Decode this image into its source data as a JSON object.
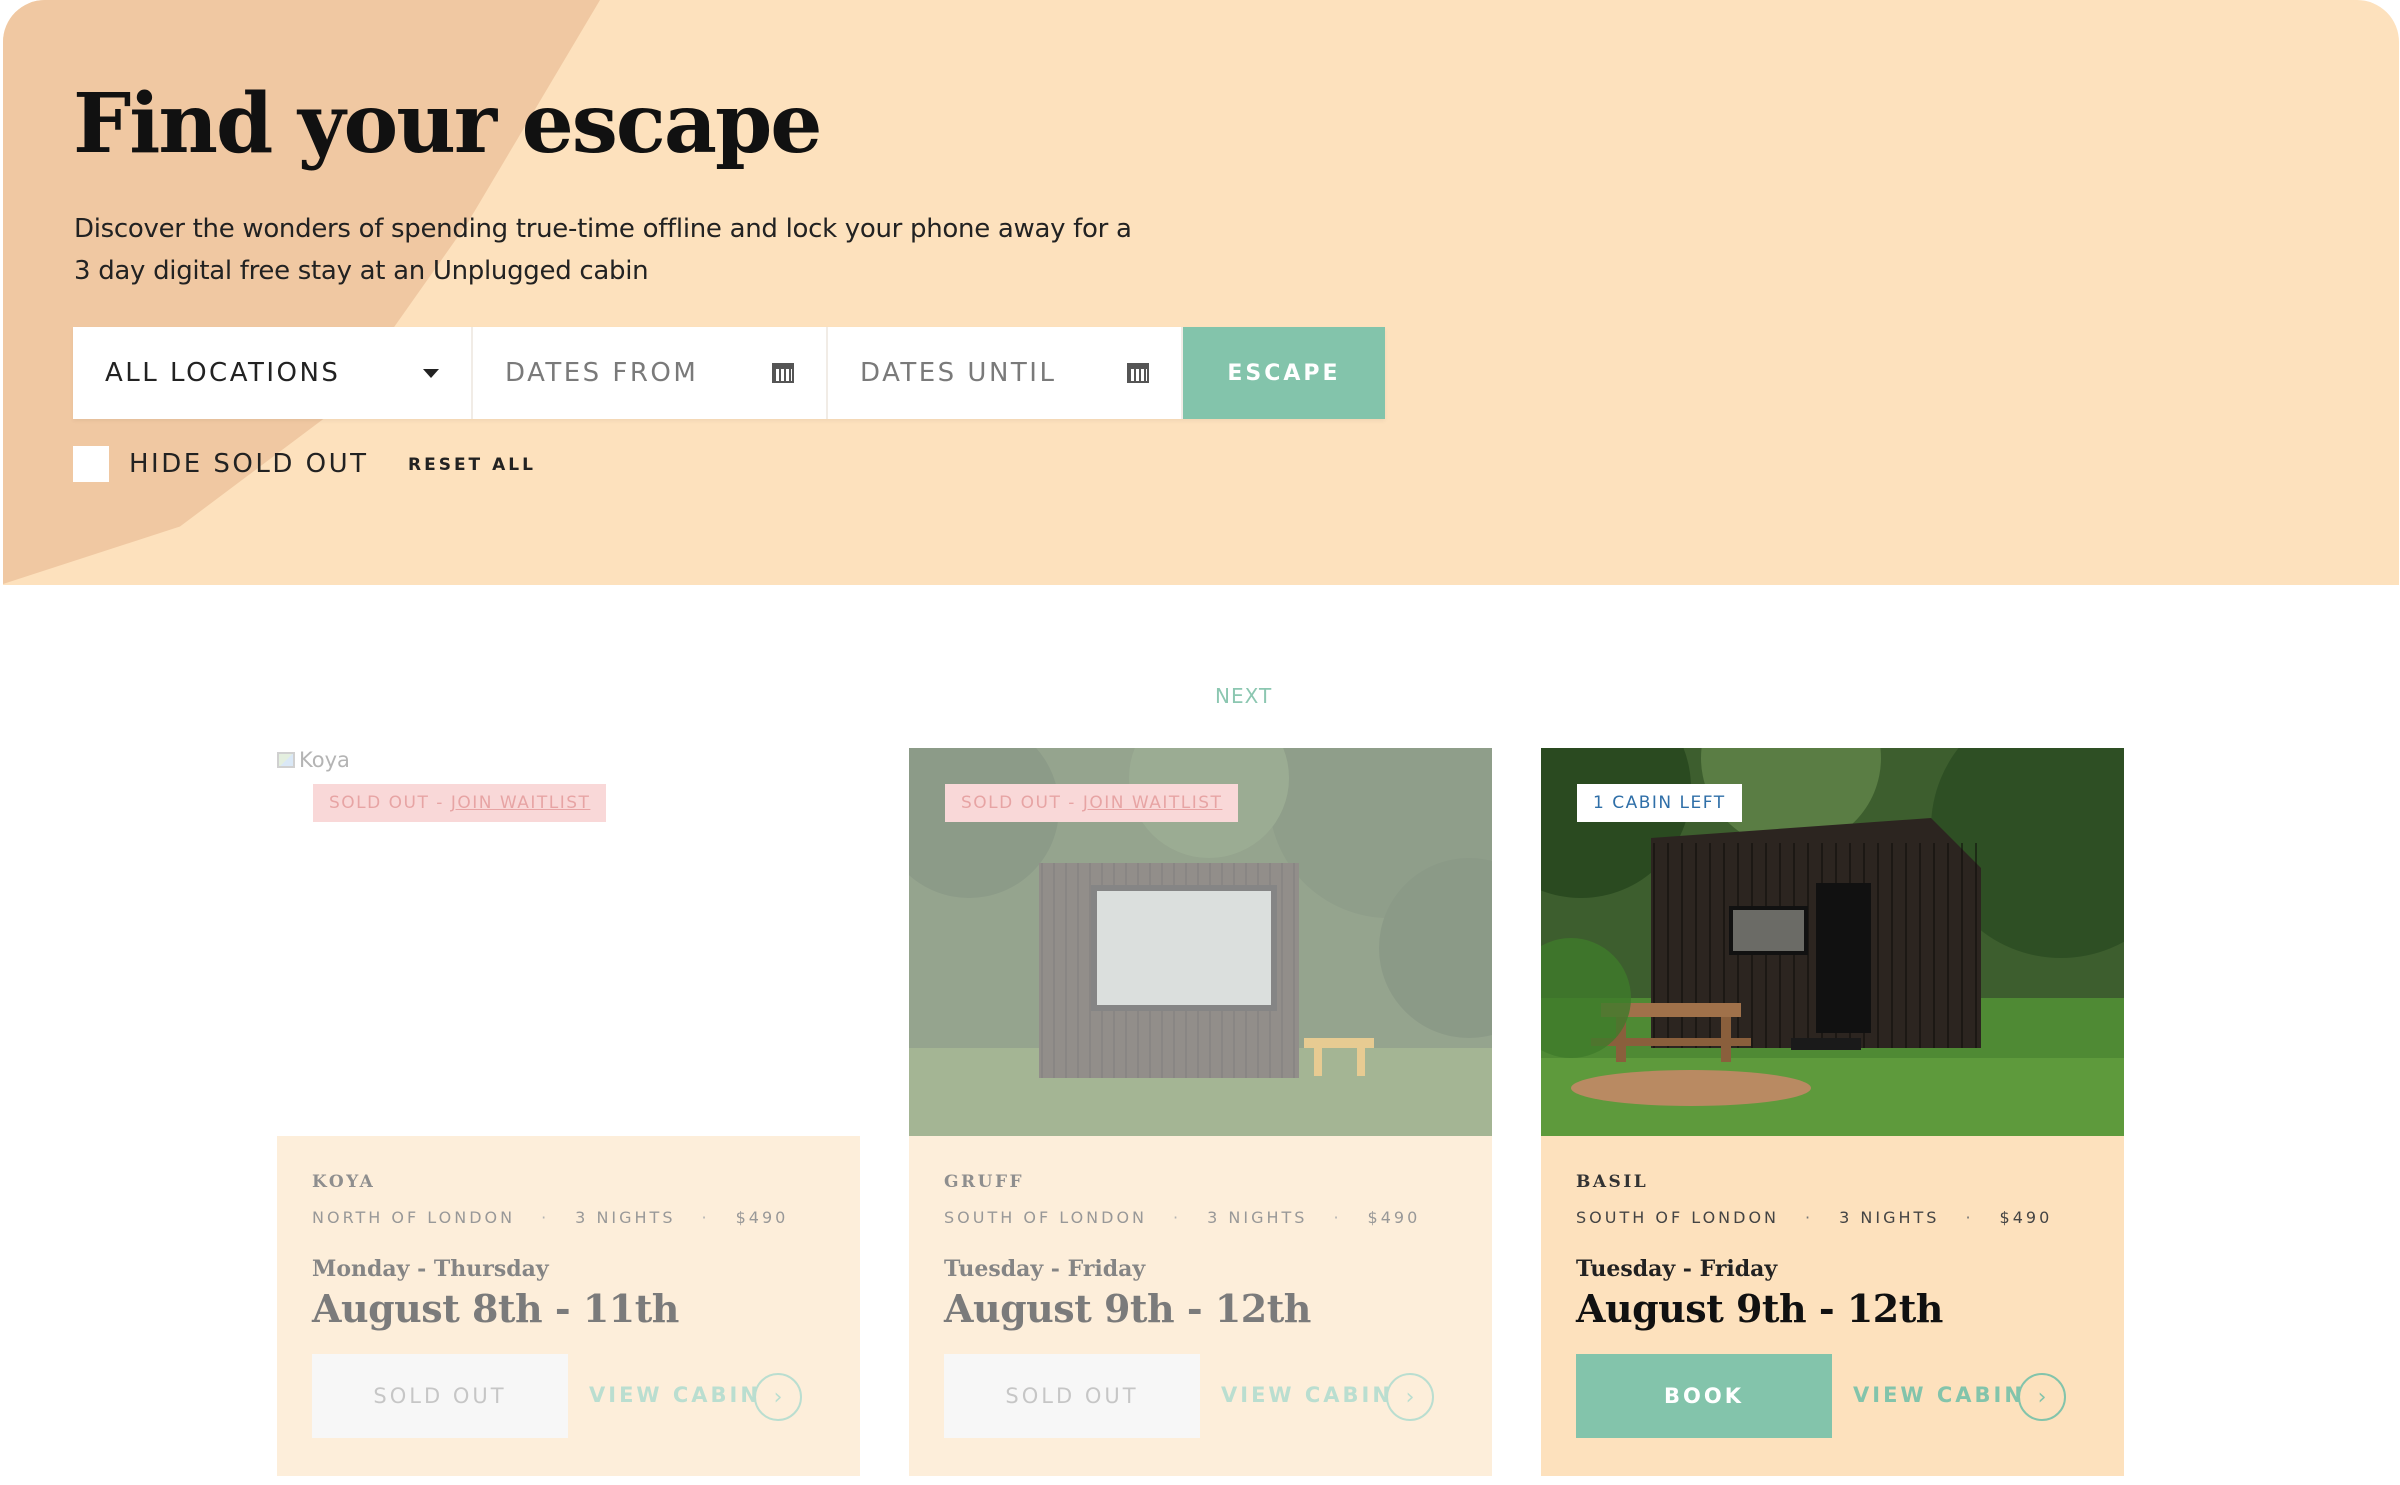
{
  "hero": {
    "title": "Find your escape",
    "description": "Discover the wonders of spending true-time offline and lock your phone away for a 3 day digital free stay at an Unplugged cabin",
    "location_value": "ALL LOCATIONS",
    "dates_from_placeholder": "DATES FROM",
    "dates_until_placeholder": "DATES UNTIL",
    "escape_label": "ESCAPE",
    "hide_sold_out_label": "HIDE SOLD OUT",
    "reset_label": "RESET ALL"
  },
  "pagination": {
    "next_label": "NEXT"
  },
  "cards": [
    {
      "name": "KOYA",
      "alt": "Koya",
      "badge_status": "SOLD OUT",
      "badge_link": "JOIN WAITLIST",
      "location": "NORTH OF LONDON",
      "nights": "3 NIGHTS",
      "price": "$490",
      "days": "Monday - Thursday",
      "dates": "August 8th - 11th",
      "action_label": "SOLD OUT",
      "view_label": "VIEW CABIN"
    },
    {
      "name": "GRUFF",
      "badge_status": "SOLD OUT",
      "badge_link": "JOIN WAITLIST",
      "location": "SOUTH OF LONDON",
      "nights": "3 NIGHTS",
      "price": "$490",
      "days": "Tuesday - Friday",
      "dates": "August 9th - 12th",
      "action_label": "SOLD OUT",
      "view_label": "VIEW CABIN"
    },
    {
      "name": "BASIL",
      "badge_text": "1 CABIN LEFT",
      "location": "SOUTH OF LONDON",
      "nights": "3 NIGHTS",
      "price": "$490",
      "days": "Tuesday - Friday",
      "dates": "August 9th - 12th",
      "action_label": "BOOK",
      "view_label": "VIEW CABIN"
    }
  ],
  "colors": {
    "hero_bg": "#fde1bd",
    "hero_blob": "#f0c8a2",
    "accent_green": "#83c4ab",
    "waitlist_badge": "#f5b9b9"
  }
}
